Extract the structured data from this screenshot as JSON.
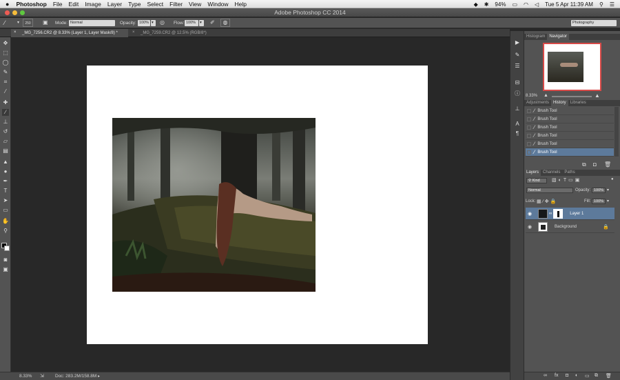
{
  "menubar": {
    "app_name": "Photoshop",
    "items": [
      "File",
      "Edit",
      "Image",
      "Layer",
      "Type",
      "Select",
      "Filter",
      "View",
      "Window",
      "Help"
    ],
    "battery": "94%",
    "clock": "Tue 5 Apr  11:39 AM"
  },
  "titlebar": {
    "title": "Adobe Photoshop CC 2014"
  },
  "options": {
    "brush_size": "250",
    "mode_label": "Mode:",
    "mode_value": "Normal",
    "opacity_label": "Opacity:",
    "opacity_value": "100%",
    "flow_label": "Flow:",
    "flow_value": "100%",
    "workspace": "Photography"
  },
  "tabs": [
    {
      "label": "_MG_7256.CR2 @ 8.33% (Layer 1, Layer Mask/8) *"
    },
    {
      "label": "_MG_7259.CR2 @ 12.5% (RGB/8*)"
    }
  ],
  "status": {
    "zoom": "8.33%",
    "doc": "Doc: 283.2M/158.8M"
  },
  "navigator": {
    "tabs": [
      "Histogram",
      "Navigator"
    ],
    "zoom": "8.33%"
  },
  "history": {
    "tabs": [
      "Adjustments",
      "History",
      "Libraries"
    ],
    "items": [
      "Brush Tool",
      "Brush Tool",
      "Brush Tool",
      "Brush Tool",
      "Brush Tool",
      "Brush Tool"
    ]
  },
  "layers": {
    "tabs": [
      "Layers",
      "Channels",
      "Paths"
    ],
    "kind": "Kind",
    "blend": "Normal",
    "opacity_label": "Opacity:",
    "opacity_value": "100%",
    "lock_label": "Lock:",
    "fill_label": "Fill:",
    "fill_value": "100%",
    "items": [
      {
        "name": "Layer 1"
      },
      {
        "name": "Background"
      }
    ]
  },
  "colors": {
    "accent": "#5d7a9b",
    "chrome": "#535353",
    "canvas": "#282828"
  }
}
